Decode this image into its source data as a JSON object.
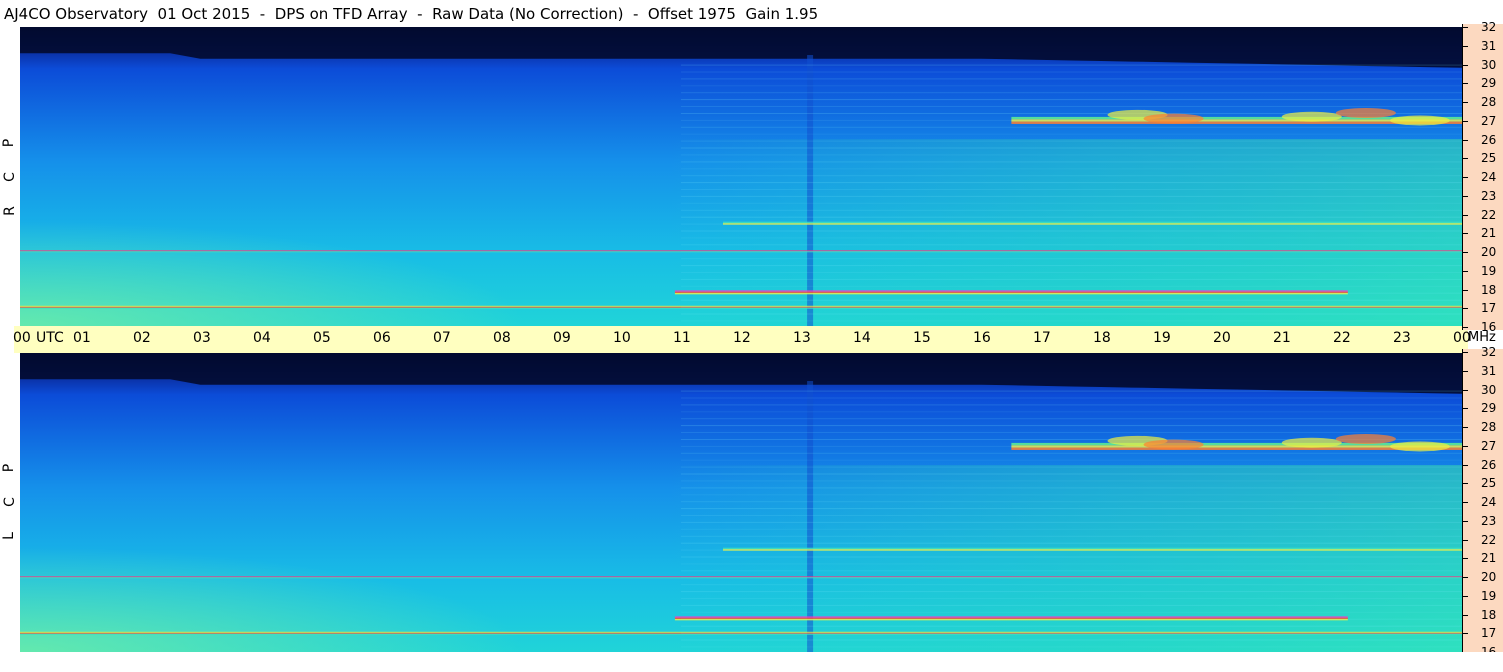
{
  "title": "AJ4CO Observatory  01 Oct 2015  -  DPS on TFD Array  -  Raw Data (No Correction)  -  Offset 1975  Gain 1.95",
  "panels": [
    {
      "id": "rcp",
      "label_letters": [
        "P",
        "C",
        "R"
      ]
    },
    {
      "id": "lcp",
      "label_letters": [
        "P",
        "C",
        "L"
      ]
    }
  ],
  "time_axis": {
    "labels": [
      "00",
      "01",
      "02",
      "03",
      "04",
      "05",
      "06",
      "07",
      "08",
      "09",
      "10",
      "11",
      "12",
      "13",
      "14",
      "15",
      "16",
      "17",
      "18",
      "19",
      "20",
      "21",
      "22",
      "23",
      "00"
    ],
    "unit_label": "UTC",
    "end_unit_label": "MHz"
  },
  "freq_axis": {
    "labels": [
      "32",
      "31",
      "30",
      "29",
      "28",
      "27",
      "26",
      "25",
      "24",
      "23",
      "22",
      "21",
      "20",
      "19",
      "18",
      "17",
      "16"
    ]
  },
  "chart_data": [
    {
      "type": "heatmap",
      "title": "AJ4CO Observatory  01 Oct 2015  -  DPS on TFD Array  -  Raw Data (No Correction)  -  Offset 1975  Gain 1.95",
      "panel": "R C P",
      "x_range_utc_hours": [
        0,
        24
      ],
      "y_range_mhz": [
        16,
        32
      ],
      "bright_bands_mhz": [
        27,
        21.5,
        20,
        17.8,
        17
      ],
      "activity_onset_utc_hour": 11,
      "quiet_top_band_mhz": [
        30,
        32
      ],
      "colormap": [
        "#02103a",
        "#0b3bd0",
        "#1a8af0",
        "#18c8e8",
        "#4ef0a0",
        "#f0f040",
        "#ff5030",
        "#ff30d0"
      ]
    },
    {
      "type": "heatmap",
      "title": "AJ4CO Observatory  01 Oct 2015  -  DPS on TFD Array  -  Raw Data (No Correction)  -  Offset 1975  Gain 1.95",
      "panel": "L C P",
      "x_range_utc_hours": [
        0,
        24
      ],
      "y_range_mhz": [
        16,
        32
      ],
      "bright_bands_mhz": [
        27,
        21.5,
        20,
        17.8,
        17
      ],
      "activity_onset_utc_hour": 11,
      "quiet_top_band_mhz": [
        30,
        32
      ],
      "colormap": [
        "#02103a",
        "#0b3bd0",
        "#1a8af0",
        "#18c8e8",
        "#4ef0a0",
        "#f0f040",
        "#ff5030",
        "#ff30d0"
      ]
    }
  ]
}
